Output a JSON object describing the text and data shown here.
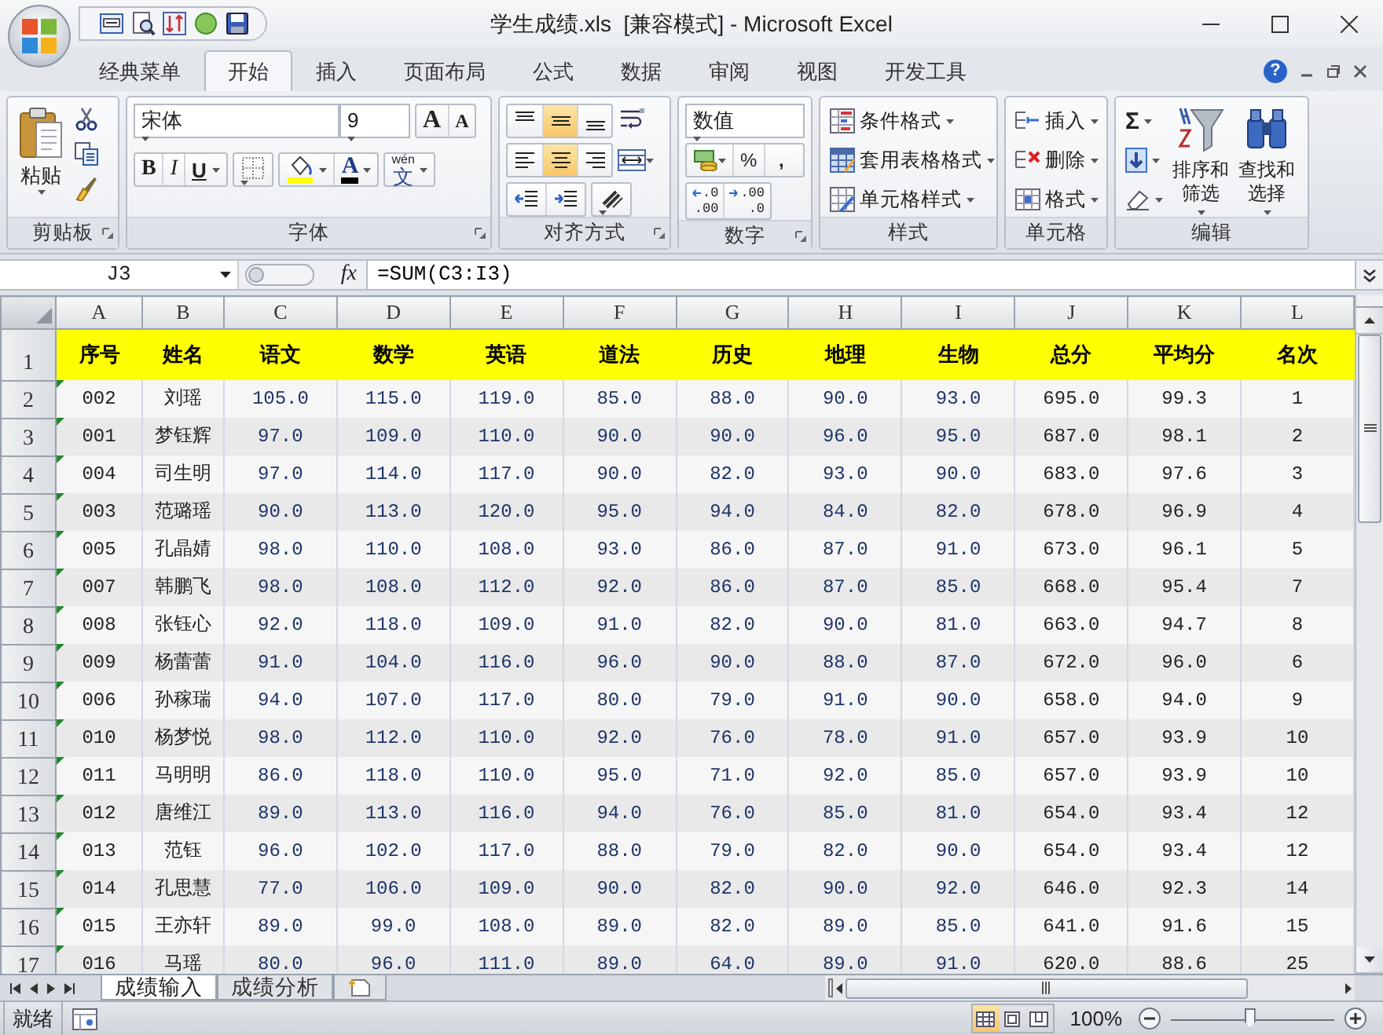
{
  "window": {
    "title": "学生成绩.xls  [兼容模式] - Microsoft Excel"
  },
  "ribbon_tabs": [
    {
      "label": "经典菜单",
      "selected": false
    },
    {
      "label": "开始",
      "selected": true
    },
    {
      "label": "插入",
      "selected": false
    },
    {
      "label": "页面布局",
      "selected": false
    },
    {
      "label": "公式",
      "selected": false
    },
    {
      "label": "数据",
      "selected": false
    },
    {
      "label": "审阅",
      "selected": false
    },
    {
      "label": "视图",
      "selected": false
    },
    {
      "label": "开发工具",
      "selected": false
    }
  ],
  "help": "?",
  "clipboard": {
    "paste": "粘贴",
    "label": "剪贴板"
  },
  "font": {
    "name": "宋体",
    "size": "9",
    "grow": "A",
    "shrink": "A",
    "bold": "B",
    "italic": "I",
    "underline": "U",
    "color_letter": "A",
    "phonetic_top": "wén",
    "phonetic_char": "文",
    "label": "字体"
  },
  "alignment": {
    "vertical": [
      {
        "selected": false
      },
      {
        "selected": true
      },
      {
        "selected": false
      }
    ],
    "horizontal": [
      {
        "selected": false
      },
      {
        "selected": true
      },
      {
        "selected": false
      }
    ],
    "label": "对齐方式"
  },
  "number": {
    "format": "数值",
    "percent": "%",
    "comma": ",",
    "decimals": [
      {
        "top": ".0",
        "bottom": ".00"
      },
      {
        "top": ".00",
        "bottom": ".0"
      }
    ],
    "label": "数字"
  },
  "styles": {
    "items": [
      "条件格式",
      "套用表格格式",
      "单元格样式"
    ],
    "label": "样式"
  },
  "cells": {
    "items": [
      "插入",
      "删除",
      "格式"
    ],
    "label": "单元格"
  },
  "editing": {
    "sum": "Σ",
    "sort": "排序和筛选",
    "find": "查找和选择",
    "label": "编辑"
  },
  "formula_bar": {
    "name_box": "J3",
    "fx": "fx",
    "formula": "=SUM(C3:I3)"
  },
  "sheet": {
    "columns": [
      "A",
      "B",
      "C",
      "D",
      "E",
      "F",
      "G",
      "H",
      "I",
      "J",
      "K",
      "L"
    ],
    "rows": [
      {
        "row": "1",
        "kind": "header",
        "cells": [
          "序号",
          "姓名",
          "语文",
          "数学",
          "英语",
          "道法",
          "历史",
          "地理",
          "生物",
          "总分",
          "平均分",
          "名次"
        ]
      },
      {
        "row": "2",
        "kind": "data",
        "error_flag": true,
        "cells": [
          "002",
          "刘瑶",
          "105.0",
          "115.0",
          "119.0",
          "85.0",
          "88.0",
          "90.0",
          "93.0",
          "695.0",
          "99.3",
          "1"
        ]
      },
      {
        "row": "3",
        "kind": "data",
        "error_flag": true,
        "cells": [
          "001",
          "梦钰辉",
          "97.0",
          "109.0",
          "110.0",
          "90.0",
          "90.0",
          "96.0",
          "95.0",
          "687.0",
          "98.1",
          "2"
        ]
      },
      {
        "row": "4",
        "kind": "data",
        "error_flag": true,
        "cells": [
          "004",
          "司生明",
          "97.0",
          "114.0",
          "117.0",
          "90.0",
          "82.0",
          "93.0",
          "90.0",
          "683.0",
          "97.6",
          "3"
        ]
      },
      {
        "row": "5",
        "kind": "data",
        "error_flag": true,
        "cells": [
          "003",
          "范璐瑶",
          "90.0",
          "113.0",
          "120.0",
          "95.0",
          "94.0",
          "84.0",
          "82.0",
          "678.0",
          "96.9",
          "4"
        ]
      },
      {
        "row": "6",
        "kind": "data",
        "error_flag": true,
        "cells": [
          "005",
          "孔晶婧",
          "98.0",
          "110.0",
          "108.0",
          "93.0",
          "86.0",
          "87.0",
          "91.0",
          "673.0",
          "96.1",
          "5"
        ]
      },
      {
        "row": "7",
        "kind": "data",
        "error_flag": true,
        "cells": [
          "007",
          "韩鹏飞",
          "98.0",
          "108.0",
          "112.0",
          "92.0",
          "86.0",
          "87.0",
          "85.0",
          "668.0",
          "95.4",
          "7"
        ]
      },
      {
        "row": "8",
        "kind": "data",
        "error_flag": true,
        "cells": [
          "008",
          "张钰心",
          "92.0",
          "118.0",
          "109.0",
          "91.0",
          "82.0",
          "90.0",
          "81.0",
          "663.0",
          "94.7",
          "8"
        ]
      },
      {
        "row": "9",
        "kind": "data",
        "error_flag": true,
        "cells": [
          "009",
          "杨蕾蕾",
          "91.0",
          "104.0",
          "116.0",
          "96.0",
          "90.0",
          "88.0",
          "87.0",
          "672.0",
          "96.0",
          "6"
        ]
      },
      {
        "row": "10",
        "kind": "data",
        "error_flag": true,
        "cells": [
          "006",
          "孙稼瑞",
          "94.0",
          "107.0",
          "117.0",
          "80.0",
          "79.0",
          "91.0",
          "90.0",
          "658.0",
          "94.0",
          "9"
        ]
      },
      {
        "row": "11",
        "kind": "data",
        "error_flag": true,
        "cells": [
          "010",
          "杨梦悦",
          "98.0",
          "112.0",
          "110.0",
          "92.0",
          "76.0",
          "78.0",
          "91.0",
          "657.0",
          "93.9",
          "10"
        ]
      },
      {
        "row": "12",
        "kind": "data",
        "error_flag": true,
        "cells": [
          "011",
          "马明明",
          "86.0",
          "118.0",
          "110.0",
          "95.0",
          "71.0",
          "92.0",
          "85.0",
          "657.0",
          "93.9",
          "10"
        ]
      },
      {
        "row": "13",
        "kind": "data",
        "error_flag": true,
        "cells": [
          "012",
          "唐维江",
          "89.0",
          "113.0",
          "116.0",
          "94.0",
          "76.0",
          "85.0",
          "81.0",
          "654.0",
          "93.4",
          "12"
        ]
      },
      {
        "row": "14",
        "kind": "data",
        "error_flag": true,
        "cells": [
          "013",
          "范钰",
          "96.0",
          "102.0",
          "117.0",
          "88.0",
          "79.0",
          "82.0",
          "90.0",
          "654.0",
          "93.4",
          "12"
        ]
      },
      {
        "row": "15",
        "kind": "data",
        "error_flag": true,
        "cells": [
          "014",
          "孔思慧",
          "77.0",
          "106.0",
          "109.0",
          "90.0",
          "82.0",
          "90.0",
          "92.0",
          "646.0",
          "92.3",
          "14"
        ]
      },
      {
        "row": "16",
        "kind": "data",
        "error_flag": true,
        "cells": [
          "015",
          "王亦轩",
          "89.0",
          "99.0",
          "108.0",
          "89.0",
          "82.0",
          "89.0",
          "85.0",
          "641.0",
          "91.6",
          "15"
        ]
      },
      {
        "row": "17",
        "kind": "data",
        "error_flag": true,
        "cells": [
          "016",
          "马瑶",
          "80.0",
          "96.0",
          "111.0",
          "89.0",
          "64.0",
          "89.0",
          "91.0",
          "620.0",
          "88.6",
          "25"
        ]
      }
    ]
  },
  "sheet_tabs": [
    {
      "label": "成绩输入",
      "selected": true
    },
    {
      "label": "成绩分析",
      "selected": false
    }
  ],
  "status_bar": {
    "status": "就绪",
    "views": [
      {
        "selected": true
      },
      {
        "selected": false
      },
      {
        "selected": false
      }
    ],
    "zoom": "100%",
    "zoom_slider": {
      "level": 0.48
    }
  }
}
